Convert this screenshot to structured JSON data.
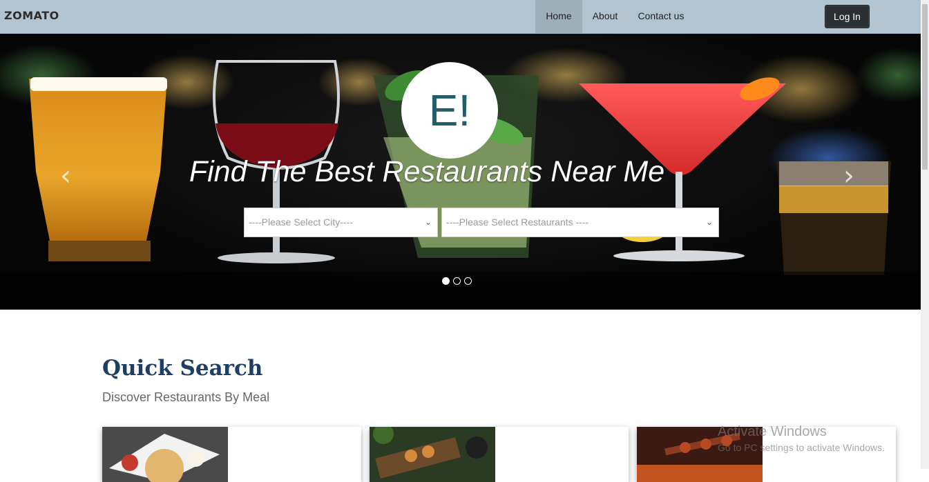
{
  "navbar": {
    "brand": "ZOMATO",
    "items": [
      {
        "label": "Home",
        "active": true
      },
      {
        "label": "About",
        "active": false
      },
      {
        "label": "Contact us",
        "active": false
      }
    ],
    "login_label": "Log In"
  },
  "hero": {
    "logo_text": "E!",
    "title": "Find The Best Restaurants Near Me",
    "city_placeholder": "----Please Select City----",
    "restaurant_placeholder": "----Please Select Restaurants ----",
    "slide_count": 3,
    "active_slide": 1
  },
  "quick_search": {
    "title": "Quick Search",
    "subtitle": "Discover Restaurants By Meal"
  },
  "watermark": {
    "title": "Activate Windows",
    "subtitle": "Go to PC settings to activate Windows."
  },
  "colors": {
    "navbar_bg": "#b1c4cf",
    "title_color": "#1e3e64",
    "logo_text_color": "#1f5e6a"
  }
}
